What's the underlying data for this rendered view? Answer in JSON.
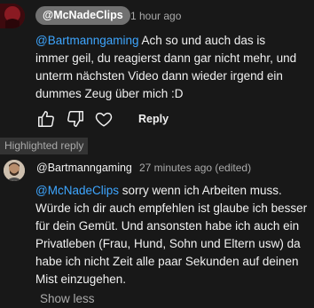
{
  "comment": {
    "author": "@McNadeClips",
    "timestamp": "1 hour ago",
    "mention": "@Bartmanngaming",
    "text": " Ach so und auch das is immer geil, du reagierst dann gar nicht mehr, und unterm nächsten Video dann wieder irgend ein dummes Zeug über mich :D",
    "actions": {
      "like_icon": "thumbs-up-icon",
      "dislike_icon": "thumbs-down-icon",
      "heart_icon": "heart-icon",
      "reply_label": "Reply"
    }
  },
  "highlighted_label": "Highlighted reply",
  "reply": {
    "author": "@Bartmanngaming",
    "timestamp": "27 minutes ago (edited)",
    "mention": "@McNadeClips",
    "text": " sorry wenn ich Arbeiten muss. Würde ich dir auch empfehlen ist glaube ich besser für dein Gemüt. Und ansonsten habe ich auch ein Privatleben (Frau, Hund, Sohn und Eltern usw) da habe ich nicht Zeit alle paar Sekunden auf deinen Mist einzugehen."
  },
  "show_less_label": "Show less",
  "colors": {
    "background": "#181818",
    "mention": "#3ea6ff",
    "author_chip": "#717171",
    "secondary_text": "#aaaaaa"
  }
}
